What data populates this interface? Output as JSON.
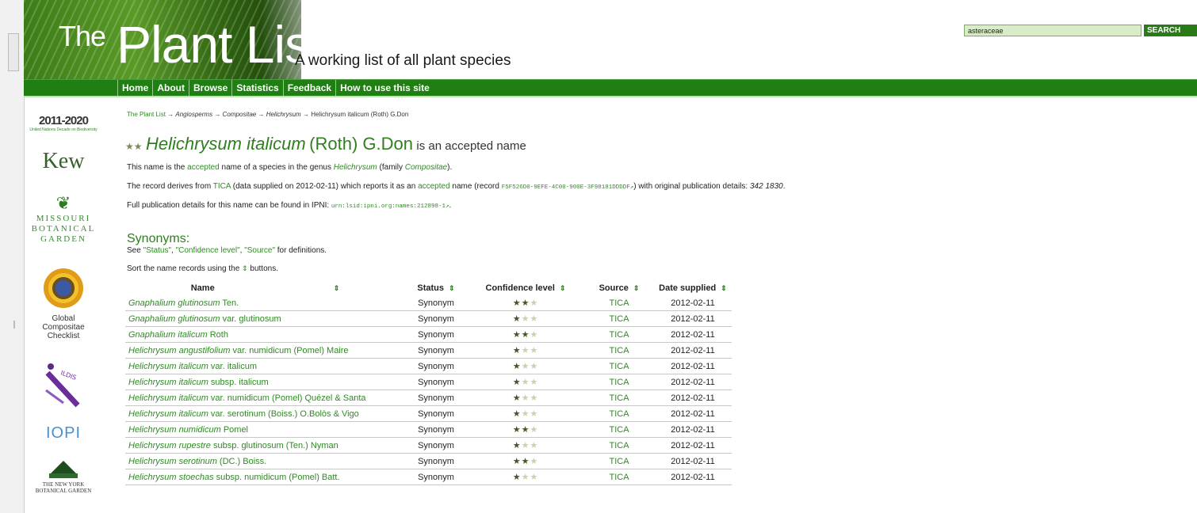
{
  "site": {
    "topline": "",
    "logo_the": "The",
    "logo_main": "Plant List",
    "tagline": "A working list of all plant species"
  },
  "search": {
    "value": "asteraceae",
    "button_label": "SEARCH"
  },
  "nav": [
    "Home",
    "About",
    "Browse",
    "Statistics",
    "Feedback",
    "How to use this site"
  ],
  "sidebar_logos": {
    "ybd": "2011-2020",
    "ybd_sub": "United Nations Decade on Biodiversity",
    "kew": "Kew",
    "mbg_lines": [
      "MISSOURI",
      "BOTANICAL",
      "GARDEN"
    ],
    "gcc_lines": [
      "Global",
      "Compositae",
      "Checklist"
    ],
    "ildis": "ILDIS",
    "iopi": "IOPI",
    "nybg_lines": [
      "THE NEW YORK",
      "BOTANICAL GARDEN"
    ]
  },
  "breadcrumb": {
    "root": "The Plant List",
    "items": [
      "Angiosperms",
      "Compositae",
      "Helichrysum",
      "Helichrysum italicum (Roth) G.Don"
    ]
  },
  "name": {
    "genus_species": "Helichrysum italicum",
    "author": "(Roth) G.Don",
    "status_phrase": "is an accepted name",
    "star_icons": "★★"
  },
  "para1": {
    "a": "This name is the ",
    "accepted": "accepted",
    "b": " name of a species in the genus ",
    "genus": "Helichrysum",
    "c": " (family ",
    "family": "Compositae",
    "d": ")."
  },
  "para2": {
    "a": "The record derives from ",
    "source": "TICA",
    "b": " (data supplied on 2012-02-11) which reports it as an ",
    "accepted": "accepted",
    "c": " name (record ",
    "record_id": "F5F526D0-9EFE-4C00-900E-3F98181DDDDF",
    "d": ") with original publication details: ",
    "pub": "342 1830",
    "e": "."
  },
  "para3": {
    "a": "Full publication details for this name can be found in IPNI: ",
    "ipni": "urn:lsid:ipni.org:names:212898-1",
    "b": "."
  },
  "synonyms": {
    "heading": "Synonyms:",
    "see_a": "See ",
    "status": "\"Status\"",
    "conf": "\"Confidence level\"",
    "source": "\"Source\"",
    "see_b": " for definitions.",
    "sort_a": "Sort the name records using the ",
    "sort_b": " buttons.",
    "sort_icon": "⇕",
    "columns": [
      "Name",
      "Status",
      "Confidence level",
      "Source",
      "Date supplied"
    ],
    "rows": [
      {
        "name_it": "Gnaphalium glutinosum",
        "rest": " Ten.",
        "status": "Synonym",
        "conf": 2,
        "source": "TICA",
        "date": "2012-02-11"
      },
      {
        "name_it": "Gnaphalium glutinosum",
        "rest": " var. glutinosum",
        "status": "Synonym",
        "conf": 1,
        "source": "TICA",
        "date": "2012-02-11"
      },
      {
        "name_it": "Gnaphalium italicum",
        "rest": " Roth",
        "status": "Synonym",
        "conf": 2,
        "source": "TICA",
        "date": "2012-02-11"
      },
      {
        "name_it": "Helichrysum angustifolium",
        "rest": " var. numidicum (Pomel) Maire",
        "status": "Synonym",
        "conf": 1,
        "source": "TICA",
        "date": "2012-02-11"
      },
      {
        "name_it": "Helichrysum italicum",
        "rest": " var. italicum",
        "status": "Synonym",
        "conf": 1,
        "source": "TICA",
        "date": "2012-02-11"
      },
      {
        "name_it": "Helichrysum italicum",
        "rest": " subsp. italicum",
        "status": "Synonym",
        "conf": 1,
        "source": "TICA",
        "date": "2012-02-11"
      },
      {
        "name_it": "Helichrysum italicum",
        "rest": " var. numidicum (Pomel) Quézel & Santa",
        "status": "Synonym",
        "conf": 1,
        "source": "TICA",
        "date": "2012-02-11"
      },
      {
        "name_it": "Helichrysum italicum",
        "rest": " var. serotinum (Boiss.) O.Bolòs & Vigo",
        "status": "Synonym",
        "conf": 1,
        "source": "TICA",
        "date": "2012-02-11"
      },
      {
        "name_it": "Helichrysum numidicum",
        "rest": " Pomel",
        "status": "Synonym",
        "conf": 2,
        "source": "TICA",
        "date": "2012-02-11"
      },
      {
        "name_it": "Helichrysum rupestre",
        "rest": " subsp. glutinosum (Ten.) Nyman",
        "status": "Synonym",
        "conf": 1,
        "source": "TICA",
        "date": "2012-02-11"
      },
      {
        "name_it": "Helichrysum serotinum",
        "rest": " (DC.) Boiss.",
        "status": "Synonym",
        "conf": 2,
        "source": "TICA",
        "date": "2012-02-11"
      },
      {
        "name_it": "Helichrysum stoechas",
        "rest": " subsp. numidicum (Pomel) Batt.",
        "status": "Synonym",
        "conf": 1,
        "source": "TICA",
        "date": "2012-02-11"
      }
    ]
  },
  "colors": {
    "nav_bg": "#1f7f12",
    "link": "#2e8b22",
    "title": "#2f7f1f",
    "search_btn": "#2a7a18"
  }
}
